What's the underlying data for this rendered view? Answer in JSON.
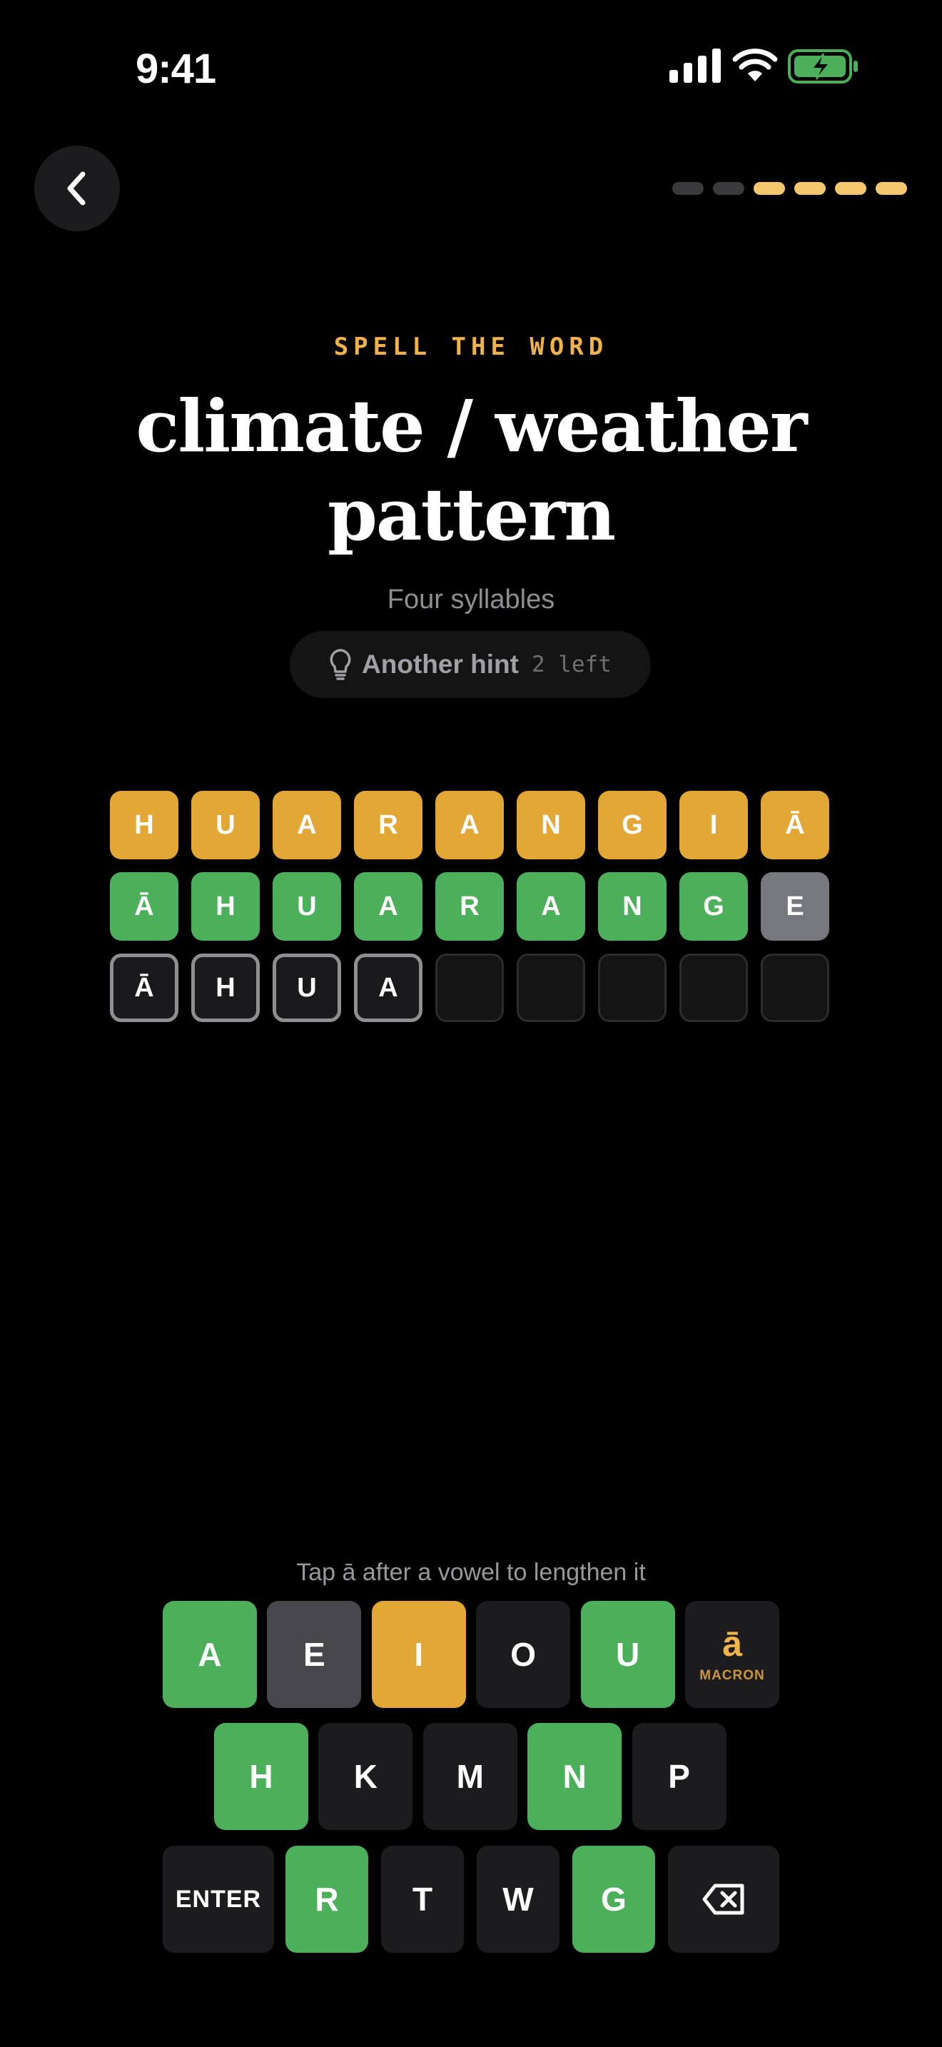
{
  "status_bar": {
    "time": "9:41"
  },
  "progress": {
    "total": 6,
    "completed": 4
  },
  "prompt": {
    "eyebrow": "SPELL THE WORD",
    "title": "climate / weather pattern",
    "subtitle": "Four syllables"
  },
  "hint": {
    "label": "Another hint",
    "remaining": "2 left"
  },
  "board": {
    "rows": [
      [
        {
          "letter": "H",
          "state": "present"
        },
        {
          "letter": "U",
          "state": "present"
        },
        {
          "letter": "A",
          "state": "present"
        },
        {
          "letter": "R",
          "state": "present"
        },
        {
          "letter": "A",
          "state": "present"
        },
        {
          "letter": "N",
          "state": "present"
        },
        {
          "letter": "G",
          "state": "present"
        },
        {
          "letter": "I",
          "state": "present"
        },
        {
          "letter": "Ā",
          "state": "present"
        }
      ],
      [
        {
          "letter": "Ā",
          "state": "correct"
        },
        {
          "letter": "H",
          "state": "correct"
        },
        {
          "letter": "U",
          "state": "correct"
        },
        {
          "letter": "A",
          "state": "correct"
        },
        {
          "letter": "R",
          "state": "correct"
        },
        {
          "letter": "A",
          "state": "correct"
        },
        {
          "letter": "N",
          "state": "correct"
        },
        {
          "letter": "G",
          "state": "correct"
        },
        {
          "letter": "E",
          "state": "absent"
        }
      ],
      [
        {
          "letter": "Ā",
          "state": "typed"
        },
        {
          "letter": "H",
          "state": "typed"
        },
        {
          "letter": "U",
          "state": "typed"
        },
        {
          "letter": "A",
          "state": "typed"
        },
        {
          "letter": "",
          "state": "empty"
        },
        {
          "letter": "",
          "state": "empty"
        },
        {
          "letter": "",
          "state": "empty"
        },
        {
          "letter": "",
          "state": "empty"
        },
        {
          "letter": "",
          "state": "empty"
        }
      ]
    ]
  },
  "keyboard": {
    "hint": "Tap ā after a vowel to lengthen it",
    "row1": [
      {
        "label": "A",
        "state": "correct"
      },
      {
        "label": "E",
        "state": "absent"
      },
      {
        "label": "I",
        "state": "present"
      },
      {
        "label": "O",
        "state": "neutral"
      },
      {
        "label": "U",
        "state": "correct"
      }
    ],
    "macron": {
      "glyph": "ā",
      "caption": "MACRON"
    },
    "row2": [
      {
        "label": "H",
        "state": "correct"
      },
      {
        "label": "K",
        "state": "neutral"
      },
      {
        "label": "M",
        "state": "neutral"
      },
      {
        "label": "N",
        "state": "correct"
      },
      {
        "label": "P",
        "state": "neutral"
      }
    ],
    "enter_label": "ENTER",
    "row3": [
      {
        "label": "R",
        "state": "correct"
      },
      {
        "label": "T",
        "state": "neutral"
      },
      {
        "label": "W",
        "state": "neutral"
      },
      {
        "label": "G",
        "state": "correct"
      }
    ],
    "backspace_icon": "backspace-icon"
  },
  "colors": {
    "present": "#e3a736",
    "correct": "#4caf5a",
    "absent": "#77777e",
    "accent": "#f0b24a",
    "progress_done": "#f5c86e",
    "progress_todo": "#3a3a3c"
  }
}
